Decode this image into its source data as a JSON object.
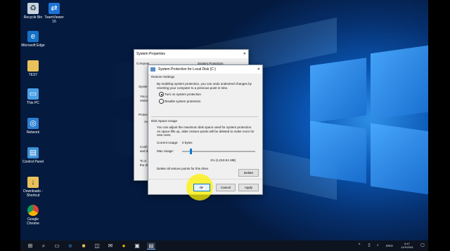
{
  "desktop_icons": [
    {
      "label": "Recycle Bin",
      "icon": "recycle-bin-icon"
    },
    {
      "label": "TeamViewer 15",
      "icon": "teamviewer-icon"
    },
    {
      "label": "Microsoft Edge",
      "icon": "edge-icon"
    },
    {
      "label": "TEST",
      "icon": "folder-icon"
    },
    {
      "label": "This PC",
      "icon": "computer-icon"
    },
    {
      "label": "Network",
      "icon": "network-icon"
    },
    {
      "label": "Control Panel",
      "icon": "control-panel-icon"
    },
    {
      "label": "Downloads - Shortcut",
      "icon": "folder-shortcut-icon"
    },
    {
      "label": "Google Chrome",
      "icon": "chrome-icon"
    }
  ],
  "background_window": {
    "title": "System Properties",
    "tab_fragment": "Compute",
    "tab_fragment_right": "System Protection",
    "texts": [
      "System",
      "You ca",
      "restor",
      "Protect",
      "Ava",
      "Confi",
      "and de",
      "To cr",
      "the dri"
    ]
  },
  "dialog": {
    "title": "System Protection for Local Disk (C:)",
    "restore_settings_heading": "Restore Settings",
    "restore_settings_desc": "By enabling system protection, you can undo undesired changes by reverting your computer to a previous point in time.",
    "radio_on": "Turn on system protection",
    "radio_off": "Disable system protection",
    "disk_heading": "Disk Space Usage",
    "disk_desc": "You can adjust the maximum disk space used for system protection. As space fills up, older restore points will be deleted to make room for new ones.",
    "current_usage_label": "Current Usage:",
    "current_usage_value": "0 bytes",
    "max_usage_label": "Max Usage:",
    "max_usage_value": "1% (1,019.51 MB)",
    "slider_level": 0.01,
    "delete_desc": "Delete all restore points for this drive.",
    "delete_button": "Delete",
    "ok_button": "OK",
    "cancel_button": "Cancel",
    "apply_button": "Apply"
  },
  "taskbar": {
    "lang": "ENG",
    "time": "8:47",
    "date": "14/9/2561",
    "icons": [
      "start-icon",
      "search-icon",
      "task-view-icon",
      "edge-icon",
      "file-explorer-icon",
      "store-icon",
      "mail-icon",
      "chrome-icon",
      "photos-icon",
      "system-properties-icon"
    ]
  },
  "colors": {
    "accent": "#0078d7",
    "highlight": "#fff200"
  }
}
